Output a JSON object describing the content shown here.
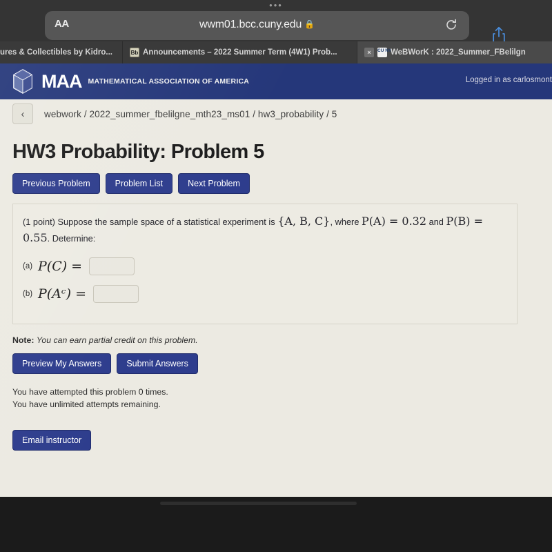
{
  "browser": {
    "text_size_button": "AA",
    "url": "wwm01.bcc.cuny.edu",
    "lock_glyph": "🔒",
    "reload_name": "reload-icon",
    "share_name": "share-icon",
    "tabs": [
      {
        "title": "ures & Collectibles by Kidro...",
        "favicon": "",
        "has_close": false
      },
      {
        "title": "Announcements – 2022 Summer Term (4W1) Prob...",
        "favicon": "Bb",
        "has_close": false
      },
      {
        "title": "WeBWorK : 2022_Summer_FBelilgn",
        "favicon": "CU NY",
        "has_close": true,
        "close_glyph": "×"
      }
    ]
  },
  "site": {
    "brand": "MAA",
    "brand_subtitle": "MATHEMATICAL ASSOCIATION OF AMERICA",
    "logged_in": "Logged in as carlosmont",
    "back_glyph": "‹",
    "breadcrumb": "webwork / 2022_summer_fbelilgne_mth23_ms01 / hw3_probability / 5"
  },
  "main": {
    "title": "HW3 Probability: Problem 5",
    "nav_buttons": [
      {
        "label": "Previous Problem"
      },
      {
        "label": "Problem List"
      },
      {
        "label": "Next Problem"
      }
    ],
    "problem": {
      "points": "(1 point)",
      "lead": "Suppose the sample space of a statistical experiment is",
      "sample_space": "{A, B, C}",
      "where": ", where",
      "pa": "P(A) = 0.32",
      "and": "and",
      "pb": "P(B) = 0.55",
      "determine": ". Determine:"
    },
    "answers": [
      {
        "label": "(a)",
        "expr": "P(C) =",
        "value": "",
        "placeholder": ""
      },
      {
        "label": "(b)",
        "expr": "P(Aᶜ) =",
        "value": "",
        "placeholder": ""
      }
    ],
    "note_label": "Note:",
    "note_text": "You can earn partial credit on this problem.",
    "action_buttons": [
      {
        "label": "Preview My Answers"
      },
      {
        "label": "Submit Answers"
      }
    ],
    "status_line_1": "You have attempted this problem 0 times.",
    "status_line_2": "You have unlimited attempts remaining.",
    "email_button": "Email instructor"
  },
  "colors": {
    "brand_navy": "#25377a",
    "button_navy": "#2e3d8d",
    "page_bg": "#eceae2",
    "chrome_bg": "#343434"
  }
}
